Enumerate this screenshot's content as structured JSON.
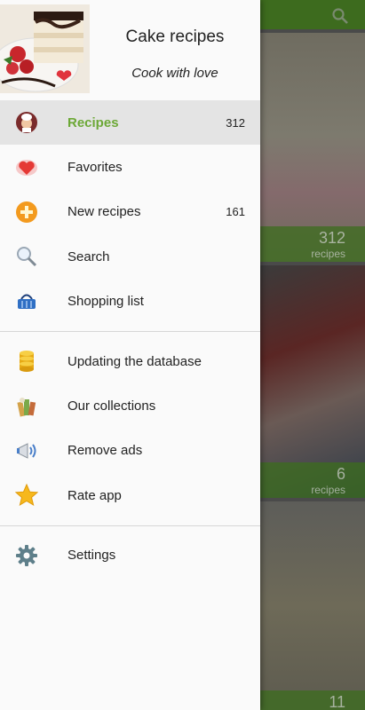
{
  "app": {
    "title": "Cake recipes",
    "subtitle": "Cook with love"
  },
  "menu": {
    "group1": [
      {
        "label": "Recipes",
        "count": "312",
        "icon": "chef-icon",
        "active": true
      },
      {
        "label": "Favorites",
        "count": "",
        "icon": "heart-icon"
      },
      {
        "label": "New recipes",
        "count": "161",
        "icon": "plus-badge-icon"
      },
      {
        "label": "Search",
        "count": "",
        "icon": "magnifier-icon"
      },
      {
        "label": "Shopping list",
        "count": "",
        "icon": "basket-icon"
      }
    ],
    "group2": [
      {
        "label": "Updating the database",
        "icon": "database-icon"
      },
      {
        "label": "Our collections",
        "icon": "books-icon"
      },
      {
        "label": "Remove ads",
        "icon": "megaphone-icon"
      },
      {
        "label": "Rate app",
        "icon": "star-icon"
      }
    ],
    "group3": [
      {
        "label": "Settings",
        "icon": "gear-icon"
      }
    ]
  },
  "background": {
    "cards": [
      {
        "count": "312",
        "label": "recipes"
      },
      {
        "count": "6",
        "label": "recipes"
      },
      {
        "count": "11",
        "label": ""
      }
    ]
  },
  "colors": {
    "accent": "#6ca836",
    "toolbar": "#3d6b1e",
    "drawer_bg": "#fafafa",
    "active_row": "#e4e4e4"
  }
}
